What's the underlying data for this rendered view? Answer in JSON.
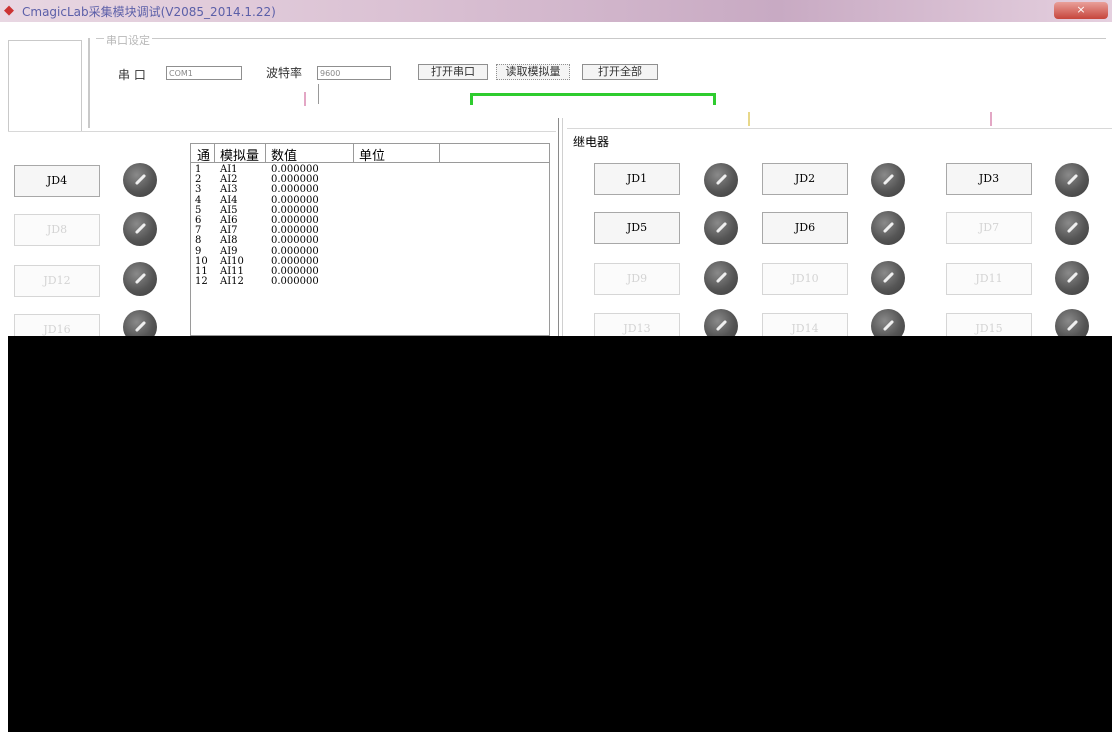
{
  "window": {
    "title": "CmagicLab采集模块调试(V2085_2014.1.22)",
    "close_label": "×"
  },
  "serial": {
    "group_title": "串口设定",
    "port_label": "串 口",
    "port_value": "COM1",
    "baud_label": "波特率",
    "baud_value": "9600",
    "open_btn": "打开串口",
    "read_btn": "读取模拟量",
    "open_all_btn": "打开全部"
  },
  "relay_section": {
    "label": "继电器"
  },
  "left_relays": [
    {
      "label": "JD4",
      "enabled": true
    },
    {
      "label": "JD8",
      "enabled": false
    },
    {
      "label": "JD12",
      "enabled": false
    },
    {
      "label": "JD16",
      "enabled": false
    }
  ],
  "right_relays": [
    {
      "label": "JD1",
      "enabled": true
    },
    {
      "label": "JD2",
      "enabled": true
    },
    {
      "label": "JD3",
      "enabled": true
    },
    {
      "label": "JD5",
      "enabled": true
    },
    {
      "label": "JD6",
      "enabled": true
    },
    {
      "label": "JD7",
      "enabled": false
    },
    {
      "label": "JD9",
      "enabled": false
    },
    {
      "label": "JD10",
      "enabled": false
    },
    {
      "label": "JD11",
      "enabled": false
    },
    {
      "label": "JD13",
      "enabled": false
    },
    {
      "label": "JD14",
      "enabled": false
    },
    {
      "label": "JD15",
      "enabled": false
    }
  ],
  "table": {
    "headers": [
      "通",
      "模拟量",
      "数值",
      "单位"
    ],
    "rows": [
      [
        "1",
        "AI1",
        "0.000000",
        ""
      ],
      [
        "2",
        "AI2",
        "0.000000",
        ""
      ],
      [
        "3",
        "AI3",
        "0.000000",
        ""
      ],
      [
        "4",
        "AI4",
        "0.000000",
        ""
      ],
      [
        "5",
        "AI5",
        "0.000000",
        ""
      ],
      [
        "6",
        "AI6",
        "0.000000",
        ""
      ],
      [
        "7",
        "AI7",
        "0.000000",
        ""
      ],
      [
        "8",
        "AI8",
        "0.000000",
        ""
      ],
      [
        "9",
        "AI9",
        "0.000000",
        ""
      ],
      [
        "10",
        "AI10",
        "0.000000",
        ""
      ],
      [
        "11",
        "AI11",
        "0.000000",
        ""
      ],
      [
        "12",
        "AI12",
        "0.000000",
        ""
      ]
    ]
  },
  "colors": {
    "accent_green": "#2ecc2e",
    "knob_dark": "#4a4a4a",
    "titlebar_pink": "#d8bfd2"
  }
}
